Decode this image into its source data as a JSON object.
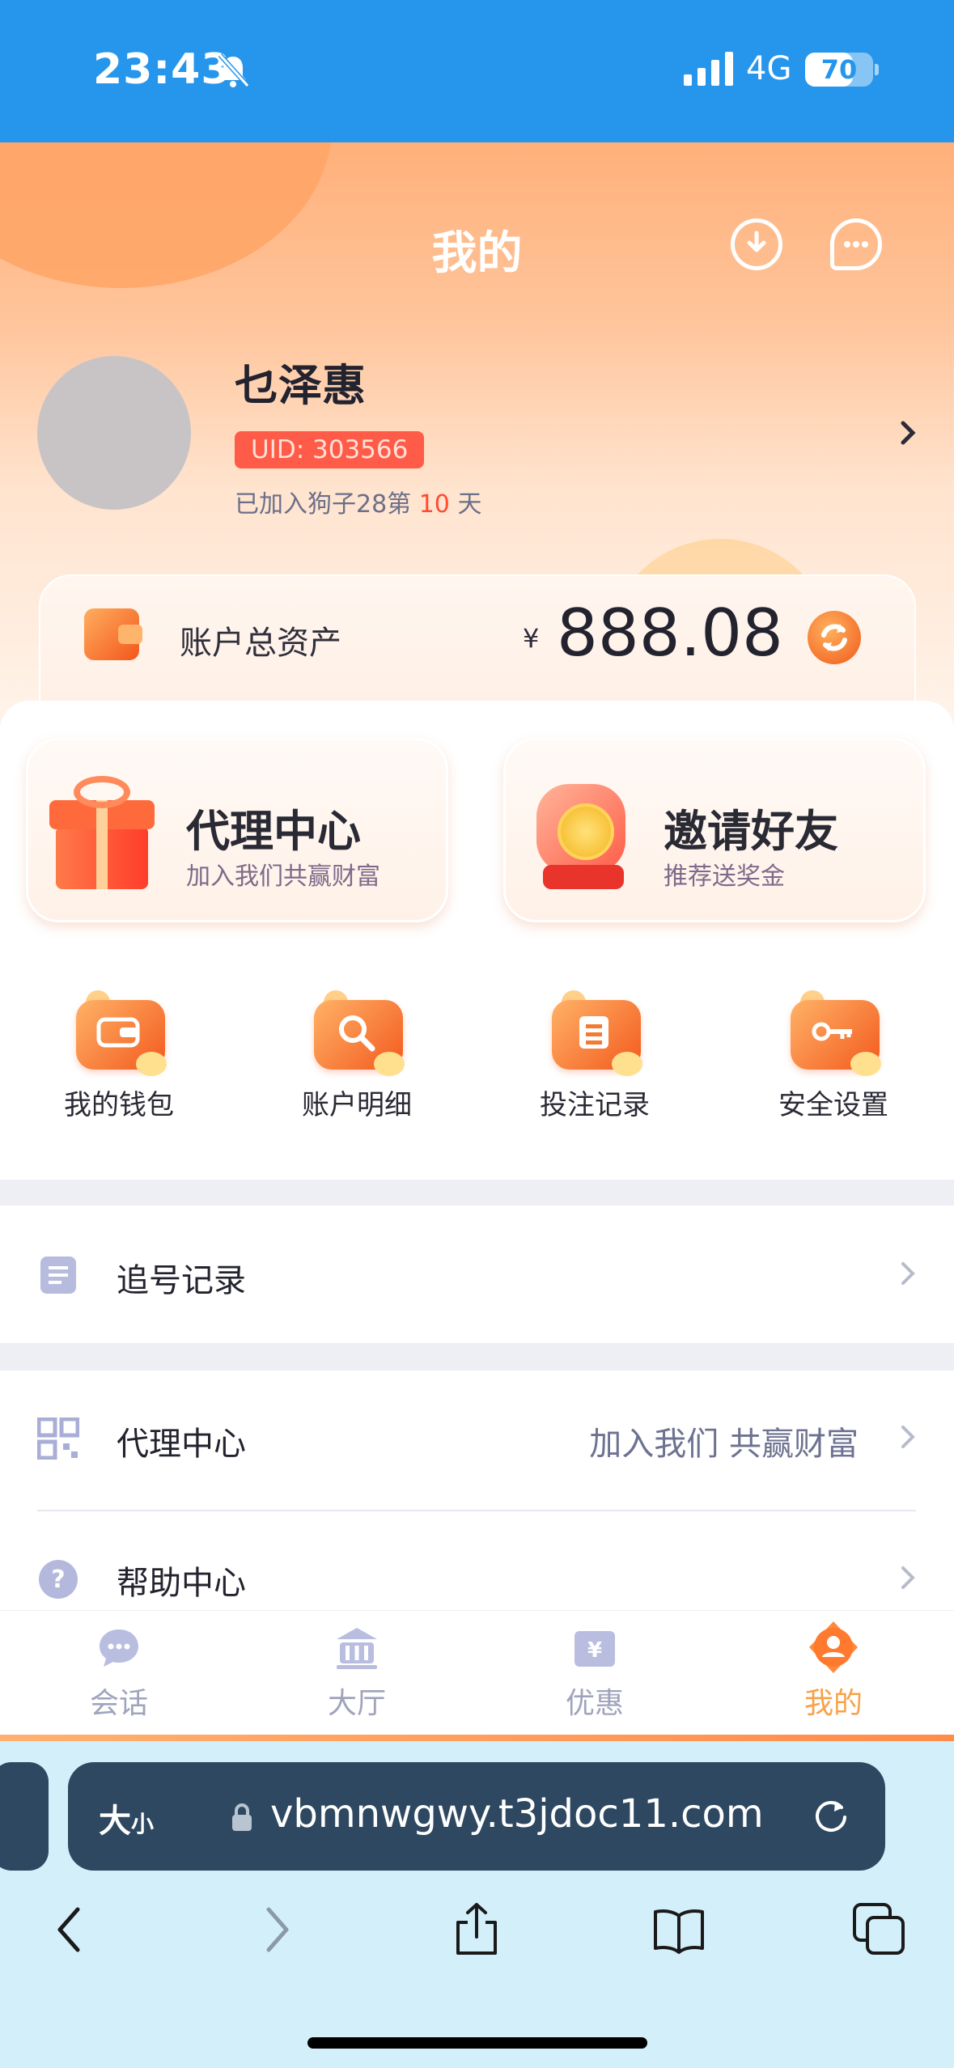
{
  "status_bar": {
    "time": "23:43",
    "network": "4G",
    "battery": "70",
    "battery_level": 0.7
  },
  "header": {
    "title": "我的"
  },
  "profile": {
    "name": "乜泽惠",
    "uid": "UID: 303566",
    "joined_prefix": "已加入狗子28第 ",
    "joined_days": "10",
    "joined_suffix": " 天"
  },
  "assets": {
    "label": "账户总资产",
    "currency": "¥",
    "amount": "888.08"
  },
  "promo_cards": [
    {
      "title": "代理中心",
      "subtitle": "加入我们共赢财富"
    },
    {
      "title": "邀请好友",
      "subtitle": "推荐送奖金"
    }
  ],
  "quick_actions": [
    {
      "label": "我的钱包",
      "icon": "wallet-icon"
    },
    {
      "label": "账户明细",
      "icon": "search-icon"
    },
    {
      "label": "投注记录",
      "icon": "notepad-icon"
    },
    {
      "label": "安全设置",
      "icon": "key-icon"
    }
  ],
  "menu": [
    {
      "label": "追号记录",
      "extra": "",
      "icon": "clipboard-icon"
    },
    {
      "label": "代理中心",
      "extra": "加入我们 共赢财富",
      "icon": "qr-code-icon"
    },
    {
      "label": "帮助中心",
      "extra": "",
      "icon": "question-icon"
    }
  ],
  "tabbar": [
    {
      "label": "会话",
      "icon": "chat-icon",
      "active": false
    },
    {
      "label": "大厅",
      "icon": "bank-icon",
      "active": false
    },
    {
      "label": "优惠",
      "icon": "coupon-icon",
      "active": false
    },
    {
      "label": "我的",
      "icon": "user-icon",
      "active": true
    }
  ],
  "browser": {
    "size_label_big": "大",
    "size_label_small": "小",
    "url": "vbmnwgwy.t3jdoc11.com"
  },
  "colors": {
    "status_bar": "#2596ec",
    "accent": "#f7a24a",
    "uid_badge": "#ff5b49",
    "highlight": "#ff4b30"
  }
}
